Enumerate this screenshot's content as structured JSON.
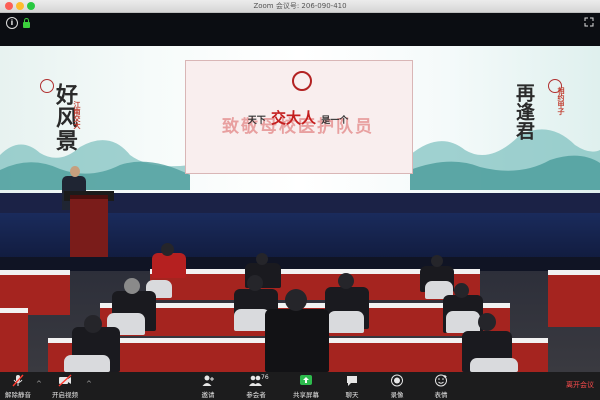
{
  "window": {
    "title": "Zoom 会议号: 206-090-410"
  },
  "screen_text": {
    "headline_main": "致敬母校医护队员",
    "headline_top": "交大人",
    "headline_prefix": "天下",
    "headline_suffix": "是一个",
    "left_calligraphy": "好风景",
    "left_small": "江南交大",
    "right_calligraphy": "再逢君",
    "right_small": "相约甲子"
  },
  "toolbar": {
    "unmute_label": "解除静音",
    "video_label": "开启视频",
    "invite_label": "邀请",
    "participants_label": "参会者",
    "participants_count": "76",
    "share_label": "共享屏幕",
    "chat_label": "聊天",
    "record_label": "录像",
    "reactions_label": "表情",
    "leave_label": "离开会议"
  },
  "colors": {
    "toolbar_bg": "#1c1c1d",
    "leave": "#ff4d4d",
    "share_green": "#2dbb4d",
    "mic_muted": "#ff3b30"
  }
}
